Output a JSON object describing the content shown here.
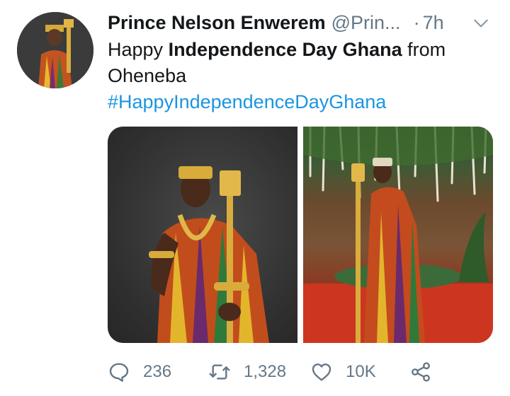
{
  "tweet": {
    "author_name": "Prince Nelson Enwerem",
    "author_handle": "@Prin...",
    "separator": "·",
    "time": "7h",
    "text_plain_1": "Happy ",
    "text_bold": "Independence Day Ghana",
    "text_plain_2": " from Oheneba",
    "hashtag": "#HappyIndependenceDayGhana",
    "media": [
      {
        "alt": "photo-left"
      },
      {
        "alt": "photo-right"
      }
    ],
    "actions": {
      "reply_count": "236",
      "retweet_count": "1,328",
      "like_count": "10K"
    }
  },
  "colors": {
    "link": "#1b95e0",
    "secondary_text": "#657786",
    "primary_text": "#14171a"
  },
  "icons": [
    "chevron-down-icon",
    "reply-icon",
    "retweet-icon",
    "like-icon",
    "share-icon"
  ]
}
